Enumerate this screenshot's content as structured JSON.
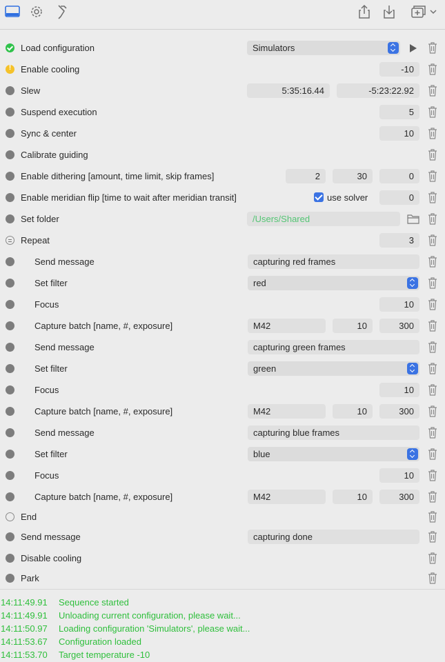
{
  "toolbar": {
    "left_icons": [
      "window-layout-icon",
      "gear-icon",
      "hammer-icon"
    ],
    "right_icons": [
      "share-icon",
      "import-icon",
      "add-window-icon",
      "chevron-down-icon"
    ]
  },
  "rows": {
    "load_configuration": {
      "label": "Load configuration",
      "status": "success",
      "value": "Simulators"
    },
    "enable_cooling": {
      "label": "Enable cooling",
      "status": "warning",
      "value": "-10"
    },
    "slew": {
      "label": "Slew",
      "status": "idle",
      "ra": "5:35:16.44",
      "dec": "-5:23:22.92"
    },
    "suspend_execution": {
      "label": "Suspend execution",
      "status": "idle",
      "value": "5"
    },
    "sync_center": {
      "label": "Sync & center",
      "status": "idle",
      "value": "10"
    },
    "calibrate_guiding": {
      "label": "Calibrate guiding",
      "status": "idle"
    },
    "enable_dithering": {
      "label": "Enable dithering [amount, time limit, skip frames]",
      "status": "idle",
      "amount": "2",
      "time_limit": "30",
      "skip_frames": "0"
    },
    "meridian_flip": {
      "label": "Enable meridian flip [time to wait after meridian transit]",
      "status": "idle",
      "use_solver_label": "use solver",
      "use_solver_checked": true,
      "value": "0"
    },
    "set_folder": {
      "label": "Set folder",
      "status": "idle",
      "value": "/Users/Shared"
    },
    "repeat": {
      "label": "Repeat",
      "status": "repeat",
      "value": "3"
    },
    "send_message_red": {
      "label": "Send message",
      "status": "idle",
      "value": "capturing red frames"
    },
    "set_filter_red": {
      "label": "Set filter",
      "status": "idle",
      "value": "red"
    },
    "focus_red": {
      "label": "Focus",
      "status": "idle",
      "value": "10"
    },
    "capture_red": {
      "label": "Capture batch [name, #, exposure]",
      "status": "idle",
      "name": "M42",
      "count": "10",
      "exposure": "300"
    },
    "send_message_green": {
      "label": "Send message",
      "status": "idle",
      "value": "capturing green frames"
    },
    "set_filter_green": {
      "label": "Set filter",
      "status": "idle",
      "value": "green"
    },
    "focus_green": {
      "label": "Focus",
      "status": "idle",
      "value": "10"
    },
    "capture_green": {
      "label": "Capture batch [name, #, exposure]",
      "status": "idle",
      "name": "M42",
      "count": "10",
      "exposure": "300"
    },
    "send_message_blue": {
      "label": "Send message",
      "status": "idle",
      "value": "capturing blue frames"
    },
    "set_filter_blue": {
      "label": "Set filter",
      "status": "idle",
      "value": "blue"
    },
    "focus_blue": {
      "label": "Focus",
      "status": "idle",
      "value": "10"
    },
    "capture_blue": {
      "label": "Capture batch [name, #, exposure]",
      "status": "idle",
      "name": "M42",
      "count": "10",
      "exposure": "300"
    },
    "end": {
      "label": "End",
      "status": "hollow"
    },
    "send_message_done": {
      "label": "Send message",
      "status": "idle",
      "value": "capturing done"
    },
    "disable_cooling": {
      "label": "Disable cooling",
      "status": "idle"
    },
    "park": {
      "label": "Park",
      "status": "idle"
    }
  },
  "log": [
    {
      "time": "14:11:49.91",
      "message": "Sequence started"
    },
    {
      "time": "14:11:49.91",
      "message": "Unloading current configuration, please wait..."
    },
    {
      "time": "14:11:50.97",
      "message": "Loading configuration 'Simulators', please wait..."
    },
    {
      "time": "14:11:53.67",
      "message": "Configuration loaded"
    },
    {
      "time": "14:11:53.70",
      "message": "Target temperature -10"
    }
  ],
  "colors": {
    "accent": "#3b73e3",
    "success": "#30c24b",
    "warning": "#f5c22a",
    "log_text": "#2fbf3c",
    "path_text": "#54c574"
  }
}
